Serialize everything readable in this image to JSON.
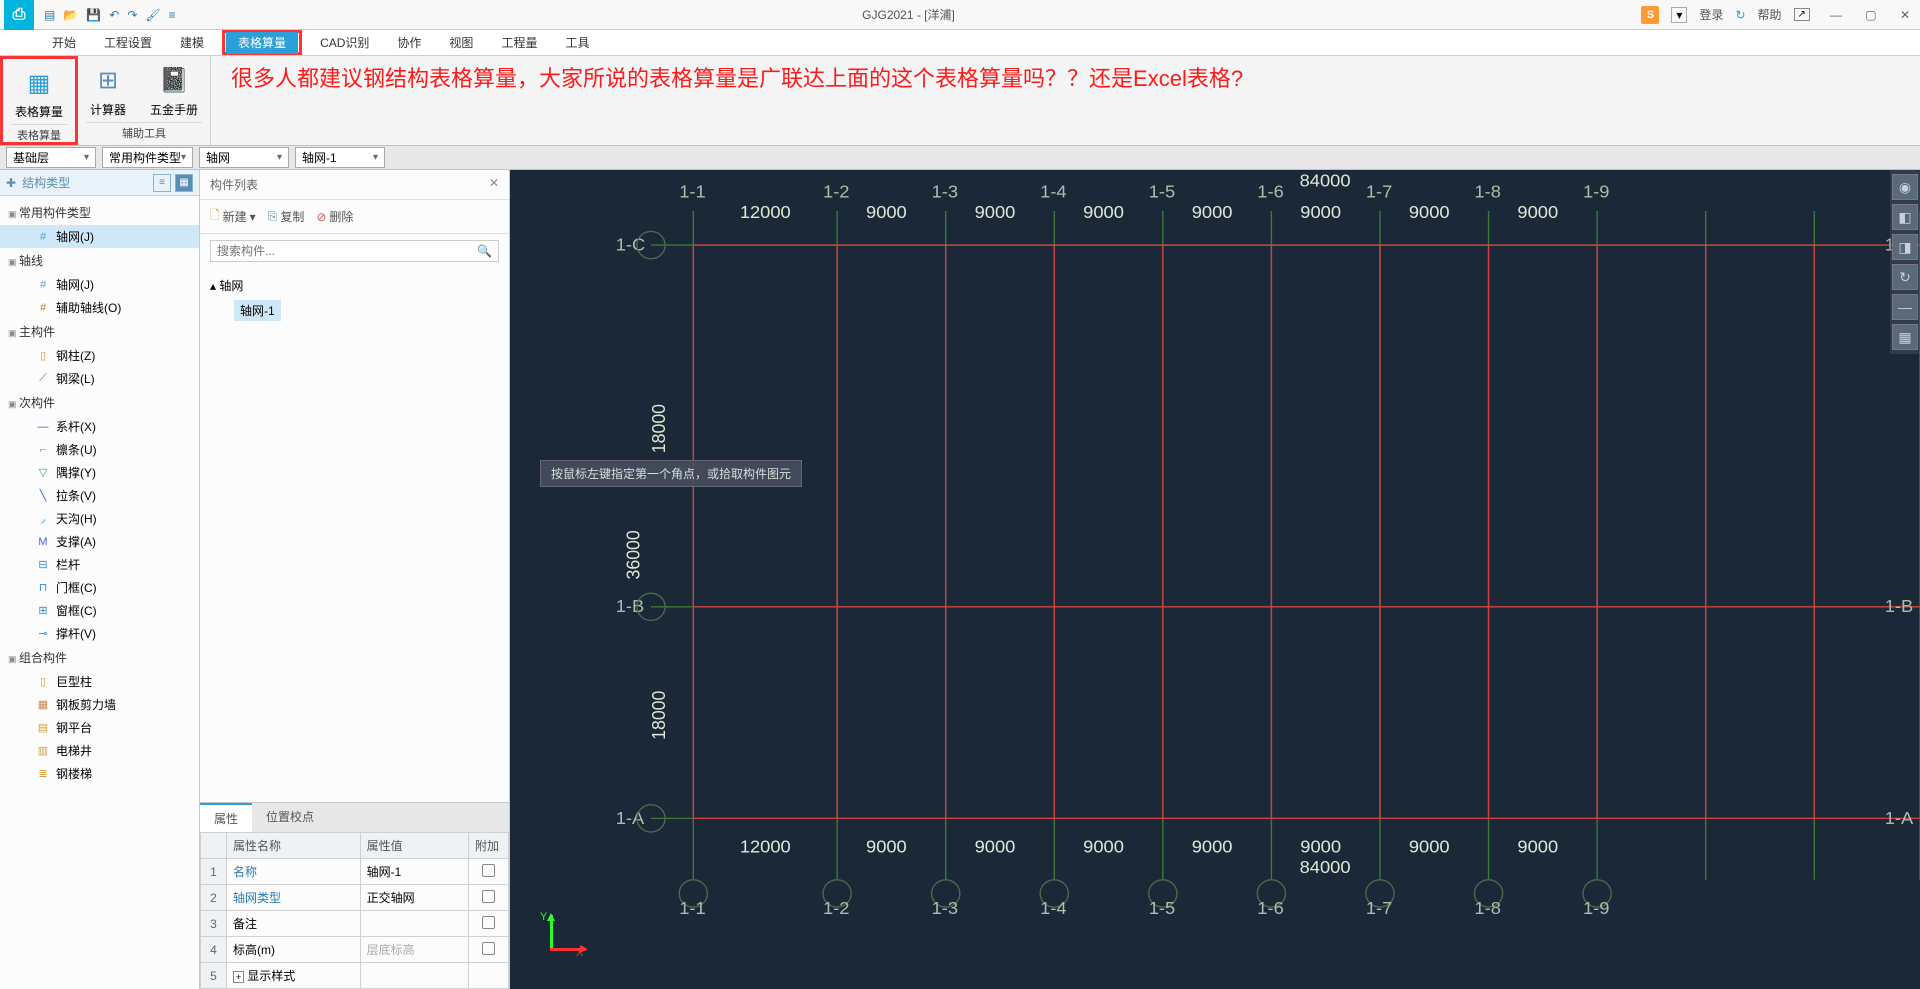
{
  "title": "GJG2021 - [洋浦]",
  "titlebar_right": {
    "login": "登录",
    "help": "帮助"
  },
  "menu": [
    "开始",
    "工程设置",
    "建模",
    "表格算量",
    "CAD识别",
    "协作",
    "视图",
    "工程量",
    "工具"
  ],
  "menu_active_index": 3,
  "ribbon": {
    "group1": {
      "btn": "表格算量",
      "label": "表格算量"
    },
    "group2": {
      "btn1": "计算器",
      "btn2": "五金手册",
      "label": "辅助工具"
    }
  },
  "overlay_text": "很多人都建议钢结构表格算量，大家所说的表格算量是广联达上面的这个表格算量吗？？还是Excel表格?",
  "dropdowns": {
    "d1": "基础层",
    "d2": "常用构件类型",
    "d3": "轴网",
    "d4": "轴网-1"
  },
  "left_panel": {
    "title": "结构类型",
    "cats": [
      {
        "name": "常用构件类型",
        "items": [
          {
            "label": "轴网(J)",
            "icon": "#",
            "c": "#4aa3e0",
            "sel": true
          }
        ]
      },
      {
        "name": "轴线",
        "items": [
          {
            "label": "轴网(J)",
            "icon": "#",
            "c": "#4aa3e0"
          },
          {
            "label": "辅助轴线(O)",
            "icon": "#",
            "c": "#c87a3a"
          }
        ]
      },
      {
        "name": "主构件",
        "items": [
          {
            "label": "钢柱(Z)",
            "icon": "▯",
            "c": "#ff8844"
          },
          {
            "label": "钢梁(L)",
            "icon": "⟋",
            "c": "#d04488"
          }
        ]
      },
      {
        "name": "次构件",
        "items": [
          {
            "label": "系杆(X)",
            "icon": "—",
            "c": "#2266cc"
          },
          {
            "label": "檩条(U)",
            "icon": "⌐",
            "c": "#5aa5dd"
          },
          {
            "label": "隅撑(Y)",
            "icon": "▽",
            "c": "#33aa77"
          },
          {
            "label": "拉条(V)",
            "icon": "╲",
            "c": "#2266cc"
          },
          {
            "label": "天沟(H)",
            "icon": "◞",
            "c": "#2288dd"
          },
          {
            "label": "支撑(A)",
            "icon": "M",
            "c": "#4466dd"
          },
          {
            "label": "栏杆",
            "icon": "⊟",
            "c": "#3388cc"
          },
          {
            "label": "门框(C)",
            "icon": "⊓",
            "c": "#3388cc"
          },
          {
            "label": "窗框(C)",
            "icon": "⊞",
            "c": "#3388cc"
          },
          {
            "label": "撑杆(V)",
            "icon": "⊸",
            "c": "#3388cc"
          }
        ]
      },
      {
        "name": "组合构件",
        "items": [
          {
            "label": "巨型柱",
            "icon": "▯",
            "c": "#d0a040"
          },
          {
            "label": "钢板剪力墙",
            "icon": "▦",
            "c": "#d08844"
          },
          {
            "label": "钢平台",
            "icon": "▤",
            "c": "#d0a040"
          },
          {
            "label": "电梯井",
            "icon": "▥",
            "c": "#d0a040"
          },
          {
            "label": "钢楼梯",
            "icon": "≣",
            "c": "#d0a040"
          }
        ]
      }
    ]
  },
  "mid_panel": {
    "title": "构件列表",
    "toolbar": {
      "new": "新建",
      "copy": "复制",
      "del": "删除"
    },
    "search_placeholder": "搜索构件...",
    "tree": {
      "root": "轴网",
      "child": "轴网-1"
    },
    "prop_tabs": [
      "属性",
      "位置校点"
    ],
    "prop_headers": [
      "属性名称",
      "属性值",
      "附加"
    ],
    "props": [
      {
        "n": "1",
        "name": "名称",
        "val": "轴网-1",
        "link": true,
        "chk": false
      },
      {
        "n": "2",
        "name": "轴网类型",
        "val": "正交轴网",
        "link": true,
        "chk": false
      },
      {
        "n": "3",
        "name": "备注",
        "val": "",
        "chk": true
      },
      {
        "n": "4",
        "name": "标高(m)",
        "val": "层底标高",
        "gray": true,
        "chk": true
      },
      {
        "n": "5",
        "name": "显示样式",
        "val": "",
        "expand": true
      }
    ]
  },
  "canvas": {
    "hint": "按鼠标左键指定第一个角点，或拾取构件图元",
    "x_labels": [
      "1-1",
      "1-2",
      "1-3",
      "1-4",
      "1-5",
      "1-6",
      "1-7",
      "1-8",
      "1-9"
    ],
    "y_labels": [
      "1-A",
      "1-B",
      "1-C"
    ],
    "top_dims": [
      "12000",
      "9000",
      "9000",
      "9000",
      "9000",
      "9000",
      "9000",
      "9000"
    ],
    "bot_dims": [
      "12000",
      "9000",
      "9000",
      "9000",
      "9000",
      "9000",
      "9000",
      "9000"
    ],
    "left_dims": [
      "18000",
      "18000"
    ],
    "left_total": "36000",
    "top_total": "84000",
    "bot_total": "84000",
    "axis": {
      "x": "X",
      "y": "Y"
    }
  }
}
